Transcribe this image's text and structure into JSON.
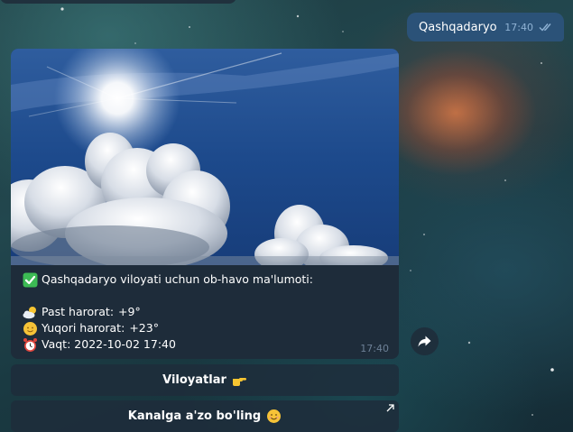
{
  "outgoing_message": {
    "text": "Qashqadaryo",
    "time": "17:40",
    "status_icon": "double-check-icon"
  },
  "incoming_message": {
    "photo": "sky-sun-clouds-photo",
    "caption": {
      "title": "Qashqadaryo viloyati uchun ob-havo ma'lumoti:",
      "title_icon": "check-mark-icon",
      "min_temp_label": "Past harorat:",
      "min_temp_value": "+9°",
      "min_temp_icon": "sun-behind-cloud-icon",
      "max_temp_label": "Yuqori harorat:",
      "max_temp_value": "+23°",
      "max_temp_icon": "sun-face-icon",
      "time_label": "Vaqt:",
      "time_value": "2022-10-02 17:40",
      "time_icon": "alarm-clock-icon"
    },
    "time": "17:40"
  },
  "share_button": {
    "icon": "share-arrow-icon"
  },
  "inline_keyboard": [
    {
      "label": "Viloyatlar",
      "icon": "pointing-hand-icon"
    },
    {
      "label": "Kanalga a'zo bo'ling",
      "icon": "smiling-face-icon",
      "corner_icon": "external-link-arrow-icon"
    }
  ],
  "colors": {
    "outgoing_bubble": "#2b5278",
    "incoming_bubble": "#1e2c3a",
    "meta_text": "#6d8096"
  }
}
